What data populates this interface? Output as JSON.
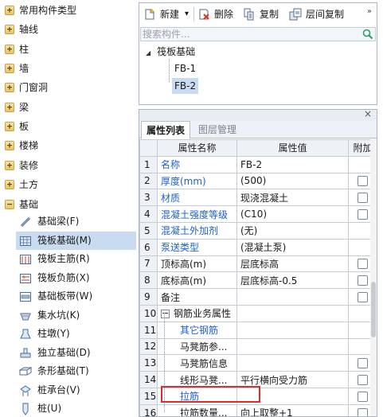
{
  "sidebar": {
    "categories_top": [
      {
        "label": "常用构件类型",
        "toggle": "+"
      },
      {
        "label": "轴线",
        "toggle": "+"
      },
      {
        "label": "柱",
        "toggle": "+"
      },
      {
        "label": "墙",
        "toggle": "+"
      },
      {
        "label": "门窗洞",
        "toggle": "+"
      },
      {
        "label": "梁",
        "toggle": "+"
      },
      {
        "label": "板",
        "toggle": "+"
      },
      {
        "label": "楼梯",
        "toggle": "+"
      },
      {
        "label": "装修",
        "toggle": "+"
      },
      {
        "label": "土方",
        "toggle": "+"
      },
      {
        "label": "基础",
        "toggle": "−"
      }
    ],
    "subitems": [
      {
        "label": "基础梁(F)",
        "icon": "foundation-beam-icon"
      },
      {
        "label": "筏板基础(M)",
        "icon": "raft-foundation-icon"
      },
      {
        "label": "筏板主筋(R)",
        "icon": "raft-main-rebar-icon"
      },
      {
        "label": "筏板负筋(X)",
        "icon": "raft-negative-rebar-icon"
      },
      {
        "label": "基础板带(W)",
        "icon": "foundation-strip-icon"
      },
      {
        "label": "集水坑(K)",
        "icon": "sump-pit-icon"
      },
      {
        "label": "柱墩(Y)",
        "icon": "column-pier-icon"
      },
      {
        "label": "独立基础(D)",
        "icon": "isolated-footing-icon"
      },
      {
        "label": "条形基础(T)",
        "icon": "strip-footing-icon"
      },
      {
        "label": "桩承台(V)",
        "icon": "pile-cap-icon"
      },
      {
        "label": "桩(U)",
        "icon": "pile-icon"
      }
    ],
    "selected_index": 1
  },
  "toolbar": {
    "new_label": "新建",
    "new_arrow": "▾",
    "delete_label": "删除",
    "copy_label": "复制",
    "floor_copy_label": "层间复制",
    "more": "»"
  },
  "search": {
    "placeholder": "搜索构件..."
  },
  "component_tree": {
    "root": "筏板基础",
    "root_toggle": "◢",
    "items": [
      "FB-1",
      "FB-2"
    ],
    "selected": "FB-2"
  },
  "props": {
    "close": "×",
    "tab_active": "属性列表",
    "tab_inactive": "图层管理",
    "col_name": "属性名称",
    "col_value": "属性值",
    "col_extra": "附加",
    "rows": [
      {
        "num": "1",
        "name": "名称",
        "value": "FB-2",
        "blue": true,
        "cb": false
      },
      {
        "num": "2",
        "name": "厚度(mm)",
        "value": "(500)",
        "blue": true,
        "cb": true
      },
      {
        "num": "3",
        "name": "材质",
        "value": "现浇混凝土",
        "blue": true,
        "cb": true
      },
      {
        "num": "4",
        "name": "混凝土强度等级",
        "value": "(C10)",
        "blue": true,
        "cb": true
      },
      {
        "num": "5",
        "name": "混凝土外加剂",
        "value": "(无)",
        "blue": true,
        "cb": false
      },
      {
        "num": "6",
        "name": "泵送类型",
        "value": "(混凝土泵)",
        "blue": true,
        "cb": false
      },
      {
        "num": "7",
        "name": "顶标高(m)",
        "value": "层底标高",
        "blue": false,
        "cb": true
      },
      {
        "num": "8",
        "name": "底标高(m)",
        "value": "层底标高-0.5",
        "blue": false,
        "cb": true
      },
      {
        "num": "9",
        "name": "备注",
        "value": "",
        "blue": false,
        "cb": true
      },
      {
        "num": "10",
        "name": "钢筋业务属性",
        "value": "",
        "blue": false,
        "cb": false,
        "group": true,
        "toggle": "−"
      },
      {
        "num": "11",
        "name": "其它钢筋",
        "value": "",
        "blue": true,
        "cb": false,
        "indent": true
      },
      {
        "num": "12",
        "name": "马凳筋参...",
        "value": "",
        "blue": false,
        "cb": false,
        "indent": true
      },
      {
        "num": "13",
        "name": "马凳筋信息",
        "value": "",
        "blue": false,
        "cb": true,
        "indent": true
      },
      {
        "num": "14",
        "name": "线形马凳...",
        "value": "平行横向受力筋",
        "blue": false,
        "cb": true,
        "indent": true
      },
      {
        "num": "15",
        "name": "拉筋",
        "value": "",
        "blue": true,
        "cb": true,
        "indent": true
      },
      {
        "num": "16",
        "name": "拉筋数量...",
        "value": "向上取整+1",
        "blue": false,
        "cb": true,
        "indent": true
      }
    ]
  },
  "colors": {
    "highlight": "#e02b2b",
    "selection": "#c9dbf1",
    "link_blue": "#1d5fd6"
  }
}
